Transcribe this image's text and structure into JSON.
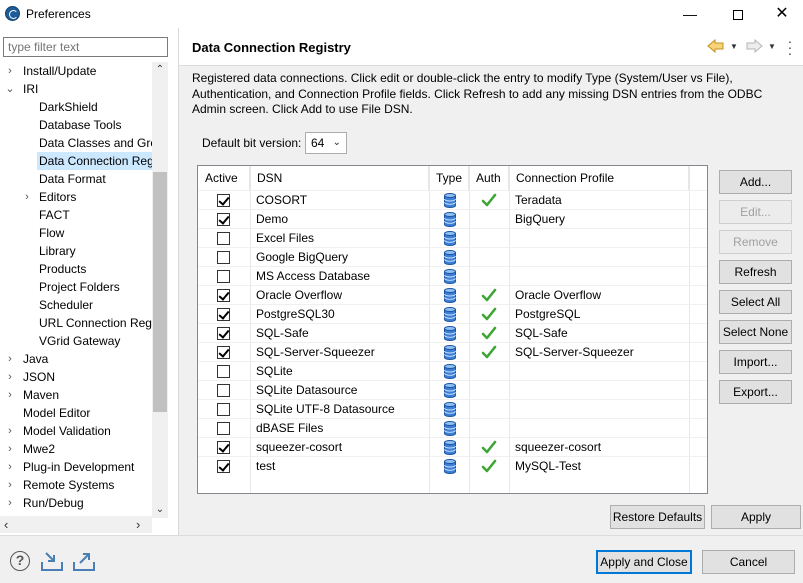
{
  "window": {
    "title": "Preferences",
    "minimize_glyph": "—",
    "close_glyph": "✕"
  },
  "sidebar": {
    "filter_placeholder": "type filter text",
    "items": [
      {
        "label": "Install/Update",
        "expander": "›"
      },
      {
        "label": "IRI",
        "expander": "⌄"
      },
      {
        "label": "DarkShield"
      },
      {
        "label": "Database Tools"
      },
      {
        "label": "Data Classes and Grou"
      },
      {
        "label": "Data Connection Reg"
      },
      {
        "label": "Data Format"
      },
      {
        "label": "Editors",
        "expander": "›"
      },
      {
        "label": "FACT"
      },
      {
        "label": "Flow"
      },
      {
        "label": "Library"
      },
      {
        "label": "Products"
      },
      {
        "label": "Project Folders"
      },
      {
        "label": "Scheduler"
      },
      {
        "label": "URL Connection Regi"
      },
      {
        "label": "VGrid Gateway"
      },
      {
        "label": "Java",
        "expander": "›"
      },
      {
        "label": "JSON",
        "expander": "›"
      },
      {
        "label": "Maven",
        "expander": "›"
      },
      {
        "label": "Model Editor"
      },
      {
        "label": "Model Validation",
        "expander": "›"
      },
      {
        "label": "Mwe2",
        "expander": "›"
      },
      {
        "label": "Plug-in Development",
        "expander": "›"
      },
      {
        "label": "Remote Systems",
        "expander": "›"
      },
      {
        "label": "Run/Debug",
        "expander": "›"
      }
    ],
    "selected_index": 5
  },
  "page": {
    "title": "Data Connection Registry",
    "description": "Registered data connections. Click edit or double-click the entry to modify Type (System/User vs File), Authentication, and Connection Profile fields. Click Refresh to add any missing DSN entries from the ODBC Admin screen. Click Add to use File DSN.",
    "bit_label": "Default bit version:",
    "bit_value": "64"
  },
  "table": {
    "columns": [
      "Active",
      "DSN",
      "Type",
      "Auth",
      "Connection Profile"
    ],
    "rows": [
      {
        "active": true,
        "dsn": "COSORT",
        "auth": true,
        "profile": "Teradata"
      },
      {
        "active": true,
        "dsn": "Demo",
        "auth": false,
        "profile": "BigQuery"
      },
      {
        "active": false,
        "dsn": "Excel Files",
        "auth": false,
        "profile": ""
      },
      {
        "active": false,
        "dsn": "Google BigQuery",
        "auth": false,
        "profile": ""
      },
      {
        "active": false,
        "dsn": "MS Access Database",
        "auth": false,
        "profile": ""
      },
      {
        "active": true,
        "dsn": "Oracle Overflow",
        "auth": true,
        "profile": "Oracle Overflow"
      },
      {
        "active": true,
        "dsn": "PostgreSQL30",
        "auth": true,
        "profile": "PostgreSQL"
      },
      {
        "active": true,
        "dsn": "SQL-Safe",
        "auth": true,
        "profile": "SQL-Safe"
      },
      {
        "active": true,
        "dsn": "SQL-Server-Squeezer",
        "auth": true,
        "profile": "SQL-Server-Squeezer"
      },
      {
        "active": false,
        "dsn": "SQLite",
        "auth": false,
        "profile": ""
      },
      {
        "active": false,
        "dsn": "SQLite Datasource",
        "auth": false,
        "profile": ""
      },
      {
        "active": false,
        "dsn": "SQLite UTF-8 Datasource",
        "auth": false,
        "profile": ""
      },
      {
        "active": false,
        "dsn": "dBASE Files",
        "auth": false,
        "profile": ""
      },
      {
        "active": true,
        "dsn": "squeezer-cosort",
        "auth": true,
        "profile": "squeezer-cosort"
      },
      {
        "active": true,
        "dsn": "test",
        "auth": true,
        "profile": "MySQL-Test"
      }
    ]
  },
  "buttons": {
    "add": "Add...",
    "edit": "Edit...",
    "remove": "Remove",
    "refresh": "Refresh",
    "select_all": "Select All",
    "select_none": "Select None",
    "import": "Import...",
    "export": "Export...",
    "restore_defaults": "Restore Defaults",
    "apply": "Apply",
    "apply_and_close": "Apply and Close",
    "cancel": "Cancel"
  },
  "footer": {
    "help_glyph": "?"
  },
  "colors": {
    "selection": "#cce8ff",
    "check_green": "#3fa535",
    "db_blue": "#3b7fd6",
    "default_button_border": "#0078d7",
    "nav_arrow": "#e8b14a"
  }
}
